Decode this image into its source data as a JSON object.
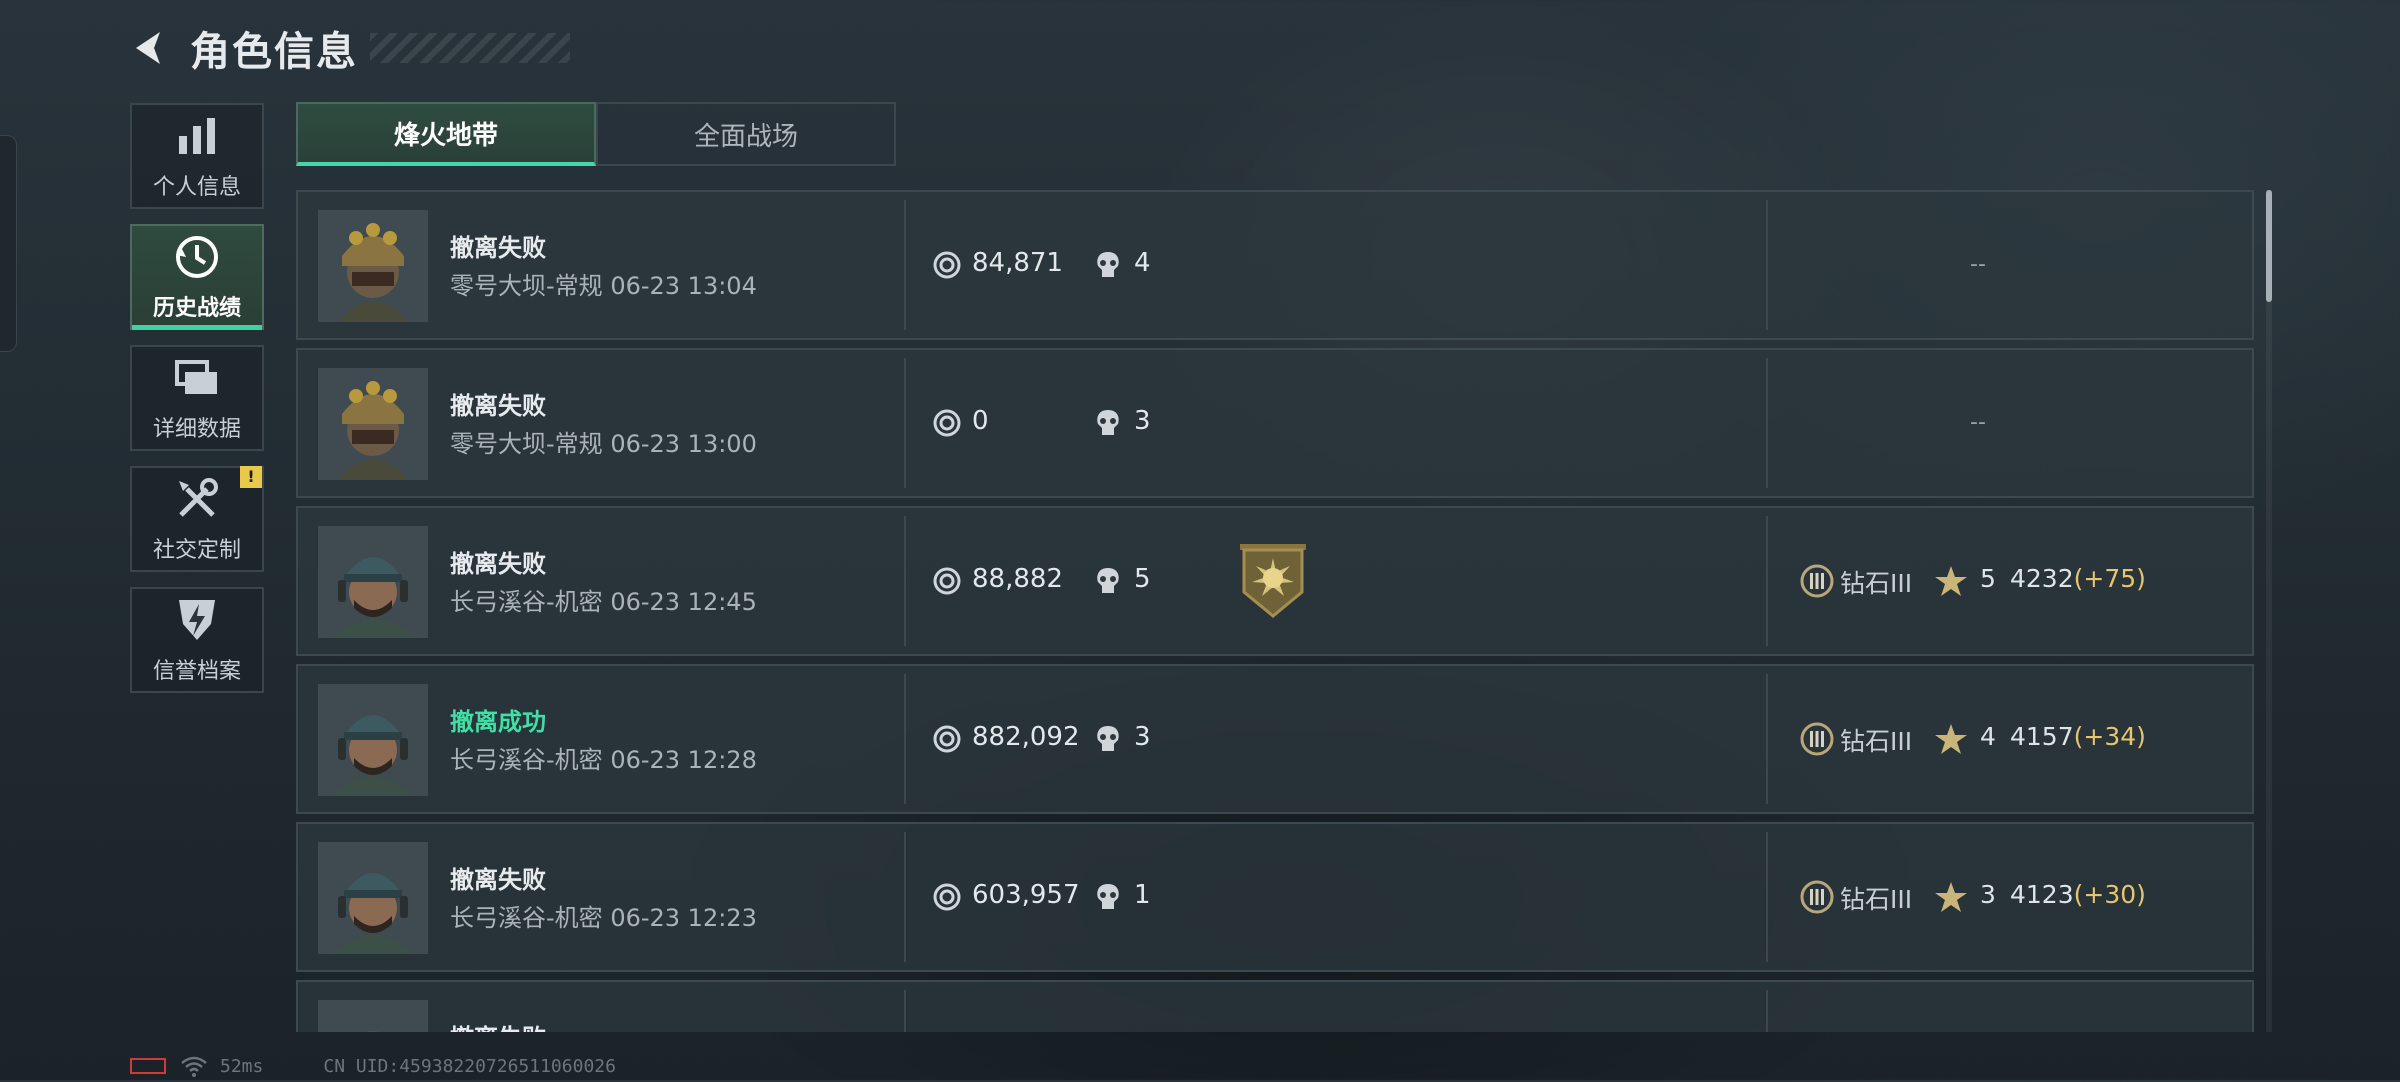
{
  "header": {
    "title": "角色信息"
  },
  "sidebar": {
    "items": [
      {
        "label": "个人信息",
        "icon": "bar-chart-icon",
        "active": false
      },
      {
        "label": "历史战绩",
        "icon": "history-clock-icon",
        "active": true
      },
      {
        "label": "详细数据",
        "icon": "folders-icon",
        "active": false
      },
      {
        "label": "社交定制",
        "icon": "tools-icon",
        "active": false,
        "badge": "!"
      },
      {
        "label": "信誉档案",
        "icon": "shield-bolt-icon",
        "active": false
      }
    ]
  },
  "tabs": [
    {
      "label": "烽火地带",
      "active": true
    },
    {
      "label": "全面战场",
      "active": false
    }
  ],
  "matches": [
    {
      "result": "撤离失败",
      "map": "零号大坝-常规",
      "time": "06-23 13:04",
      "value": "84,871",
      "kills": "4",
      "rank": null,
      "empty_text": "--"
    },
    {
      "result": "撤离失败",
      "map": "零号大坝-常规",
      "time": "06-23 13:00",
      "value": "0",
      "kills": "3",
      "rank": null,
      "empty_text": "--"
    },
    {
      "result": "撤离失败",
      "map": "长弓溪谷-机密",
      "time": "06-23 12:45",
      "value": "88,882",
      "kills": "5",
      "medal": true,
      "rank": {
        "name": "钻石III",
        "stars": "5",
        "score": "4232",
        "delta": "(+75)"
      }
    },
    {
      "result": "撤离成功",
      "map": "长弓溪谷-机密",
      "time": "06-23 12:28",
      "value": "882,092",
      "kills": "3",
      "rank": {
        "name": "钻石III",
        "stars": "4",
        "score": "4157",
        "delta": "(+34)"
      }
    },
    {
      "result": "撤离失败",
      "map": "长弓溪谷-机密",
      "time": "06-23 12:23",
      "value": "603,957",
      "kills": "1",
      "rank": {
        "name": "钻石III",
        "stars": "3",
        "score": "4123",
        "delta": "(+30)"
      }
    },
    {
      "result": "撤离失败"
    }
  ],
  "status_bar": {
    "ping": "52ms",
    "uid": "CN UID:45938220726511060026"
  },
  "colors": {
    "accent": "#3fd3a0",
    "success": "#3fe0a6",
    "delta": "#e8c56c",
    "battery": "#d13a3a"
  }
}
